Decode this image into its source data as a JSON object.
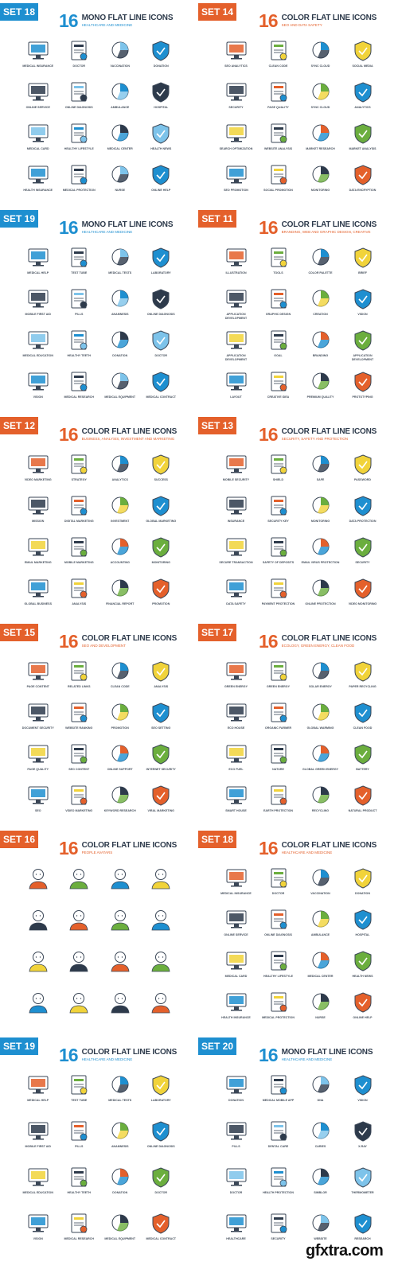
{
  "colors": {
    "blue": "#1e8fd0",
    "orange": "#e4602b",
    "dark": "#2d3a4b",
    "green": "#6bae3e",
    "yellow": "#f1d33a",
    "red": "#d94f2b"
  },
  "panels": [
    {
      "set": "SET 18",
      "count": "16",
      "title": "MONO FLAT LINE ICONS",
      "subtitle": "HEALTHCARE AND MEDICINE",
      "accent": "blue",
      "items": [
        "MEDICAL INSURANCE",
        "DOCTOR",
        "VACCINATION",
        "DONATION",
        "ONLINE SERVICE",
        "ONLINE DIAGNOSIS",
        "AMBULANCE",
        "HOSPITAL",
        "MEDICAL CARD",
        "HEALTHY LIFESTYLE",
        "MEDICAL CENTER",
        "HEALTH NEWS",
        "HEALTH INSURANCE",
        "MEDICAL PROTECTION",
        "NURSE",
        "ONLINE HELP"
      ]
    },
    {
      "set": "SET 14",
      "count": "16",
      "title": "COLOR FLAT LINE ICONS",
      "subtitle": "SEO AND DATA SAFETY",
      "accent": "orange",
      "items": [
        "SEO ANALYTICS",
        "CLEAN CODE",
        "SYNC CLOUD",
        "SOCIAL MEDIA",
        "SECURITY",
        "PAGE QUALITY",
        "SYNC CLOUD",
        "ANALYTICS",
        "SEARCH OPTIMIZATION",
        "WEBSITE ANALYSIS",
        "MARKET RESEARCH",
        "MARKET ANALYSIS",
        "SEO PROMOTION",
        "SOCIAL PROMOTION",
        "MONITORING",
        "DATA ENCRYPTION"
      ]
    },
    {
      "set": "SET 19",
      "count": "16",
      "title": "MONO FLAT LINE ICONS",
      "subtitle": "HEALTHCARE AND MEDICINE",
      "accent": "blue",
      "items": [
        "MEDICAL HELP",
        "TEST TUBE",
        "MEDICAL TESTS",
        "LABORATORY",
        "MOBILE FIRST AID",
        "PILLS",
        "ANAMNESIS",
        "ONLINE DIAGNOSIS",
        "MEDICAL EDUCATION",
        "HEALTHY TEETH",
        "DONATION",
        "DOCTOR",
        "VISION",
        "MEDICAL RESEARCH",
        "MEDICAL EQUIPMENT",
        "MEDICAL CONTRACT"
      ]
    },
    {
      "set": "SET 11",
      "count": "16",
      "title": "COLOR FLAT LINE ICONS",
      "subtitle": "BRANDING, WEB AND GRAPHIC DESIGN, CREATIVE",
      "accent": "orange",
      "items": [
        "ILLUSTRATION",
        "TOOLS",
        "COLOR PALETTE",
        "BRIEF",
        "APPLICATION DEVELOPMENT",
        "GRAPHIC DESIGN",
        "CREATION",
        "VISION",
        "APPLICATION DEVELOPMENT",
        "GOAL",
        "BRANDING",
        "APPLICATION DEVELOPMENT",
        "LAYOUT",
        "CREATIVE IDEA",
        "PREMIUM QUALITY",
        "PROTOTYPING"
      ]
    },
    {
      "set": "SET 12",
      "count": "16",
      "title": "COLOR FLAT LINE ICONS",
      "subtitle": "BUSINESS, ANALYSIS, INVESTMENT AND MARKETING",
      "accent": "orange",
      "items": [
        "VIDEO MARKETING",
        "STRATEGY",
        "ANALYTICS",
        "SUCCESS",
        "MISSION",
        "DIGITAL MARKETING",
        "INVESTMENT",
        "GLOBAL MARKETING",
        "EMAIL MARKETING",
        "MOBILE MARKETING",
        "ACCOUNTING",
        "MONITORING",
        "GLOBAL BUSINESS",
        "ANALYSIS",
        "FINANCIAL REPORT",
        "PROMOTION"
      ]
    },
    {
      "set": "SET 13",
      "count": "16",
      "title": "COLOR FLAT LINE ICONS",
      "subtitle": "SECURITY, SAFETY AND PROTECTION",
      "accent": "orange",
      "items": [
        "MOBILE SECURITY",
        "SHIELD",
        "SAFE",
        "PASSWORD",
        "INSURANCE",
        "SECURITY KEY",
        "MONITORING",
        "DATA PROTECTION",
        "SECURE TRANSACTION",
        "SAFETY OF DEPOSITS",
        "EMAIL VIRUS PROTECTION",
        "SECURITY",
        "DATA SAFETY",
        "PAYMENT PROTECTION",
        "ONLINE PROTECTION",
        "VIDEO MONITORING"
      ]
    },
    {
      "set": "SET 15",
      "count": "16",
      "title": "COLOR FLAT LINE ICONS",
      "subtitle": "SEO AND DEVELOPMENT",
      "accent": "orange",
      "items": [
        "PAGE CONTENT",
        "RELATED LINKS",
        "CLEAN CODE",
        "ANALYSIS",
        "DOCUMENT SECURITY",
        "WEBSITE RANKING",
        "PROMOTION",
        "SEO SETTING",
        "PAGE QUALITY",
        "SEO CONTENT",
        "ONLINE SUPPORT",
        "INTERNET SECURITY",
        "SEO",
        "VIDEO MARKETING",
        "KEYWORD RESEARCH",
        "VIRAL MARKETING"
      ]
    },
    {
      "set": "SET 17",
      "count": "16",
      "title": "COLOR FLAT LINE ICONS",
      "subtitle": "ECOLOGY, GREEN ENERGY, CLEAN FOOD",
      "accent": "orange",
      "items": [
        "GREEN ENERGY",
        "GREEN ENERGY",
        "SOLAR ENERGY",
        "PAPER RECYCLING",
        "ECO HOUSE",
        "ORGANIC FARMER",
        "GLOBAL WARMING",
        "CLEAN FOOD",
        "ECO FUEL",
        "NATURE",
        "GLOBAL GREEN ENERGY",
        "BATTERY",
        "SMART HOUSE",
        "EARTH PROTECTION",
        "RECYCLING",
        "NATURAL PRODUCT"
      ]
    },
    {
      "set": "SET 16",
      "count": "16",
      "title": "COLOR FLAT LINE ICONS",
      "subtitle": "PEOPLE AVATARS",
      "accent": "orange",
      "items": [
        "",
        "",
        "",
        "",
        "",
        "",
        "",
        "",
        "",
        "",
        "",
        "",
        "",
        "",
        "",
        ""
      ]
    },
    {
      "set": "SET 18",
      "count": "16",
      "title": "COLOR FLAT LINE ICONS",
      "subtitle": "HEALTHCARE AND MEDICINE",
      "accent": "orange",
      "items": [
        "MEDICAL INSURANCE",
        "DOCTOR",
        "VACCINATION",
        "DONATION",
        "ONLINE SERVICE",
        "ONLINE DIAGNOSIS",
        "AMBULANCE",
        "HOSPITAL",
        "MEDICAL CARD",
        "HEALTHY LIFESTYLE",
        "MEDICAL CENTER",
        "HEALTH NEWS",
        "HEALTH INSURANCE",
        "MEDICAL PROTECTION",
        "NURSE",
        "ONLINE HELP"
      ]
    },
    {
      "set": "SET 19",
      "count": "16",
      "title": "COLOR FLAT LINE ICONS",
      "subtitle": "HEALTHCARE AND MEDICINE",
      "accent": "blue",
      "items": [
        "MEDICAL HELP",
        "TEST TUBE",
        "MEDICAL TESTS",
        "LABORATORY",
        "MOBILE FIRST AID",
        "PILLS",
        "ANAMNESIS",
        "ONLINE DIAGNOSIS",
        "MEDICAL EDUCATION",
        "HEALTHY TEETH",
        "DONATION",
        "DOCTOR",
        "VISION",
        "MEDICAL RESEARCH",
        "MEDICAL EQUIPMENT",
        "MEDICAL CONTRACT"
      ]
    },
    {
      "set": "SET 20",
      "count": "16",
      "title": "MONO FLAT LINE ICONS",
      "subtitle": "HEALTHCARE AND MEDICINE",
      "accent": "blue",
      "items": [
        "DONATION",
        "MEDICAL MOBILE APP",
        "DNA",
        "VISION",
        "PILLS",
        "DENTAL CARE",
        "CARIES",
        "X-RAY",
        "DOCTOR",
        "HEALTH PROTECTION",
        "SIMBLOR",
        "THERMOMETER",
        "HEALTHCARE",
        "SECURITY",
        "WEBSITE",
        "RESEARCH"
      ]
    }
  ],
  "watermark": "gfxtra.com"
}
